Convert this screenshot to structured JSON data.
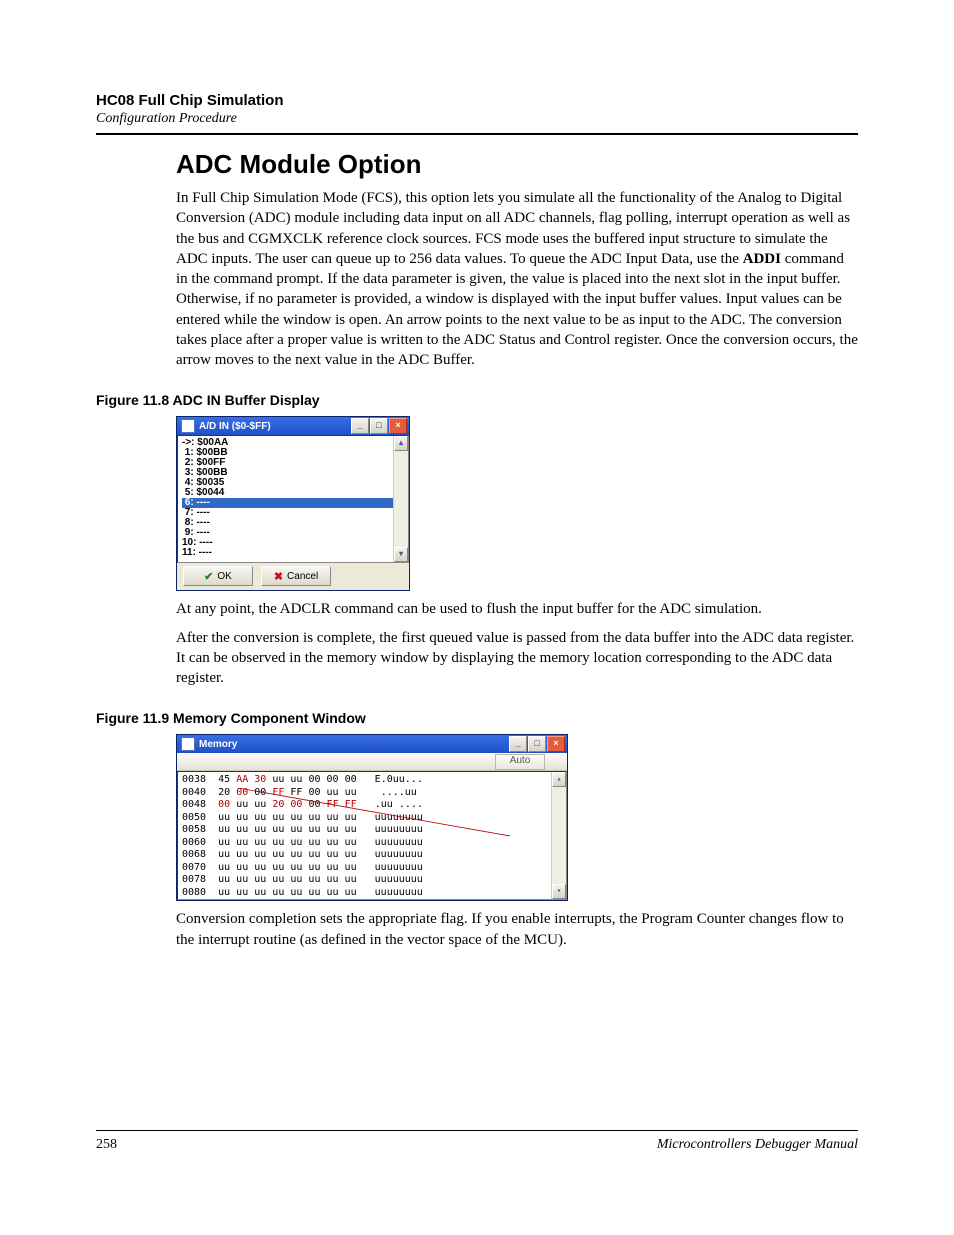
{
  "header": {
    "title": "HC08 Full Chip Simulation",
    "subtitle": "Configuration Procedure"
  },
  "section_heading": "ADC Module Option",
  "body_p1_a": "In Full Chip Simulation Mode (FCS), this option lets you simulate all the functionality of the Analog to Digital Conversion (ADC) module including data input on all ADC channels, flag polling, interrupt operation as well as the bus and CGMXCLK reference clock sources. FCS mode uses the buffered input structure to simulate the ADC inputs. The user can queue up to 256 data values. To queue the ADC Input Data, use the ",
  "body_p1_bold": "ADDI",
  "body_p1_b": " command in the command prompt. If the data parameter is given, the value is placed into the next slot in the input buffer. Otherwise, if no parameter is provided, a window is displayed with the input buffer values. Input values can be entered while the window is open. An arrow points to the next value to be as input to the ADC. The conversion takes place after a proper value is written to the ADC Status and Control register. Once the conversion occurs, the arrow moves to the next value in the ADC Buffer.",
  "fig1_caption": "Figure 11.8  ADC IN Buffer Display",
  "adc_window": {
    "title": "A/D IN ($0-$FF)",
    "rows": [
      "->: $00AA",
      " 1: $00BB",
      " 2: $00FF",
      " 3: $00BB",
      " 4: $0035",
      " 5: $0044",
      " 6: ----",
      " 7: ----",
      " 8: ----",
      " 9: ----",
      "10: ----",
      "11: ----"
    ],
    "selected_index": 6,
    "ok_label": "OK",
    "cancel_label": "Cancel"
  },
  "body_p2": "At any point, the ADCLR command can be used to flush the input buffer for the ADC simulation.",
  "body_p3": "After the conversion is complete, the first queued value is passed from the data buffer into the ADC data register. It can be observed in the memory window by displaying the memory location corresponding to the ADC data register.",
  "fig2_caption": "Figure 11.9  Memory Component Window",
  "memory_window": {
    "title": "Memory",
    "mode": "Auto",
    "rows_plain": [
      {
        "addr": "0038",
        "hex": "45 AA 30 uu uu 00 00 00",
        "asc": "E.0uu..."
      },
      {
        "addr": "0040",
        "hex": "20 00 00 FF FF 00 uu uu",
        "asc": " ....uu"
      },
      {
        "addr": "0048",
        "hex": "00 uu uu 20 00 00 FF FF",
        "asc": ".uu ...."
      },
      {
        "addr": "0050",
        "hex": "uu uu uu uu uu uu uu uu",
        "asc": "uuuuuuuu"
      },
      {
        "addr": "0058",
        "hex": "uu uu uu uu uu uu uu uu",
        "asc": "uuuuuuuu"
      },
      {
        "addr": "0060",
        "hex": "uu uu uu uu uu uu uu uu",
        "asc": "uuuuuuuu"
      },
      {
        "addr": "0068",
        "hex": "uu uu uu uu uu uu uu uu",
        "asc": "uuuuuuuu"
      },
      {
        "addr": "0070",
        "hex": "uu uu uu uu uu uu uu uu",
        "asc": "uuuuuuuu"
      },
      {
        "addr": "0078",
        "hex": "uu uu uu uu uu uu uu uu",
        "asc": "uuuuuuuu"
      },
      {
        "addr": "0080",
        "hex": "uu uu uu uu uu uu uu uu",
        "asc": "uuuuuuuu"
      }
    ],
    "red_tokens": {
      "0": [
        "AA",
        "30"
      ],
      "1": [
        "00",
        "FF"
      ],
      "2": [
        "20",
        "00",
        "00",
        "FF",
        "FF"
      ]
    }
  },
  "body_p4": "Conversion completion sets the appropriate flag. If you enable interrupts, the Program Counter changes flow to the interrupt routine (as defined in the vector space of the MCU).",
  "footer": {
    "page_number": "258",
    "manual_name": "Microcontrollers Debugger Manual"
  }
}
